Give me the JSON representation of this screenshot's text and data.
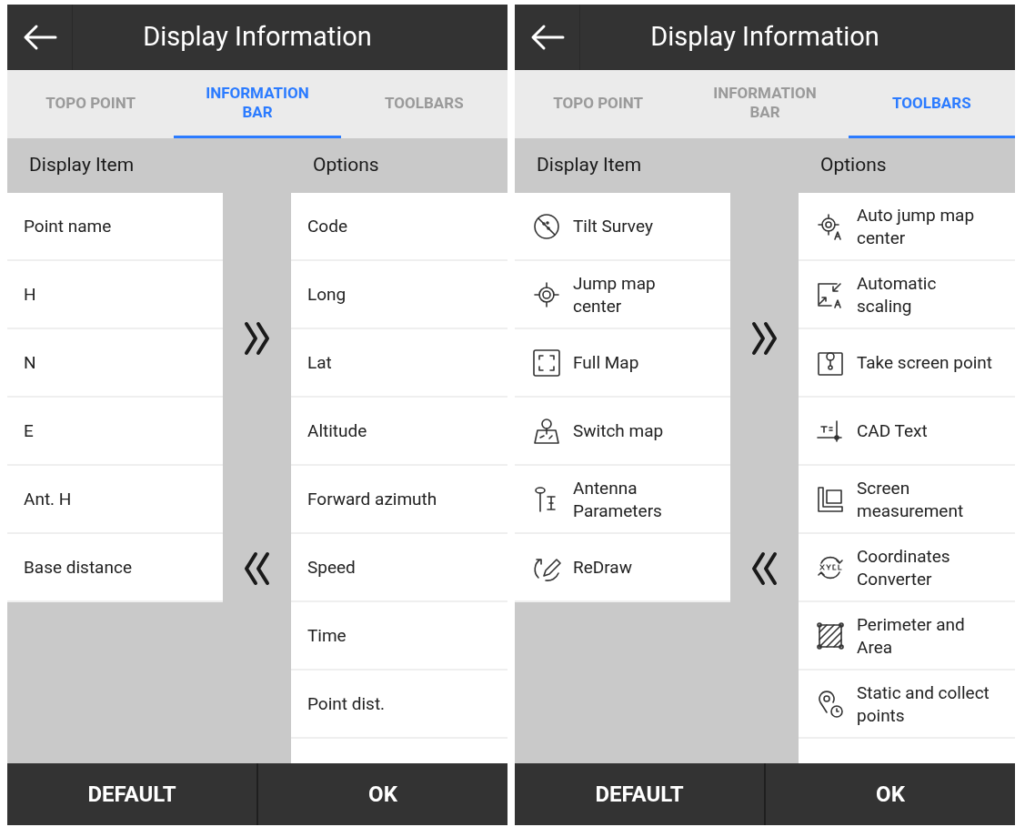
{
  "screens": [
    {
      "kind": "text",
      "title": "Display Information",
      "tabs": [
        {
          "label": "TOPO POINT",
          "selected": false
        },
        {
          "label": "INFORMATION BAR",
          "selected": true
        },
        {
          "label": "TOOLBARS",
          "selected": false
        }
      ],
      "display_heading": "Display Item",
      "options_heading": "Options",
      "display_items": [
        "Point name",
        "H",
        "N",
        "E",
        "Ant. H",
        "Base distance"
      ],
      "options": [
        "Code",
        "Long",
        "Lat",
        "Altitude",
        "Forward azimuth",
        "Speed",
        "Time",
        "Point dist."
      ],
      "buttons": [
        "DEFAULT",
        "OK"
      ]
    },
    {
      "kind": "icons",
      "title": "Display Information",
      "tabs": [
        {
          "label": "TOPO POINT",
          "selected": false
        },
        {
          "label": "INFORMATION BAR",
          "selected": false
        },
        {
          "label": "TOOLBARS",
          "selected": true
        }
      ],
      "display_heading": "Display Item",
      "options_heading": "Options",
      "display_items": [
        "Tilt Survey",
        "Jump map center",
        "Full Map",
        "Switch map",
        "Antenna Parameters",
        "ReDraw"
      ],
      "options": [
        "Auto jump map center",
        "Automatic scaling",
        "Take screen point",
        "CAD Text",
        "Screen measurement",
        "Coordinates Converter",
        "Perimeter and Area",
        "Static and collect points"
      ],
      "buttons": [
        "DEFAULT",
        "OK"
      ]
    }
  ]
}
